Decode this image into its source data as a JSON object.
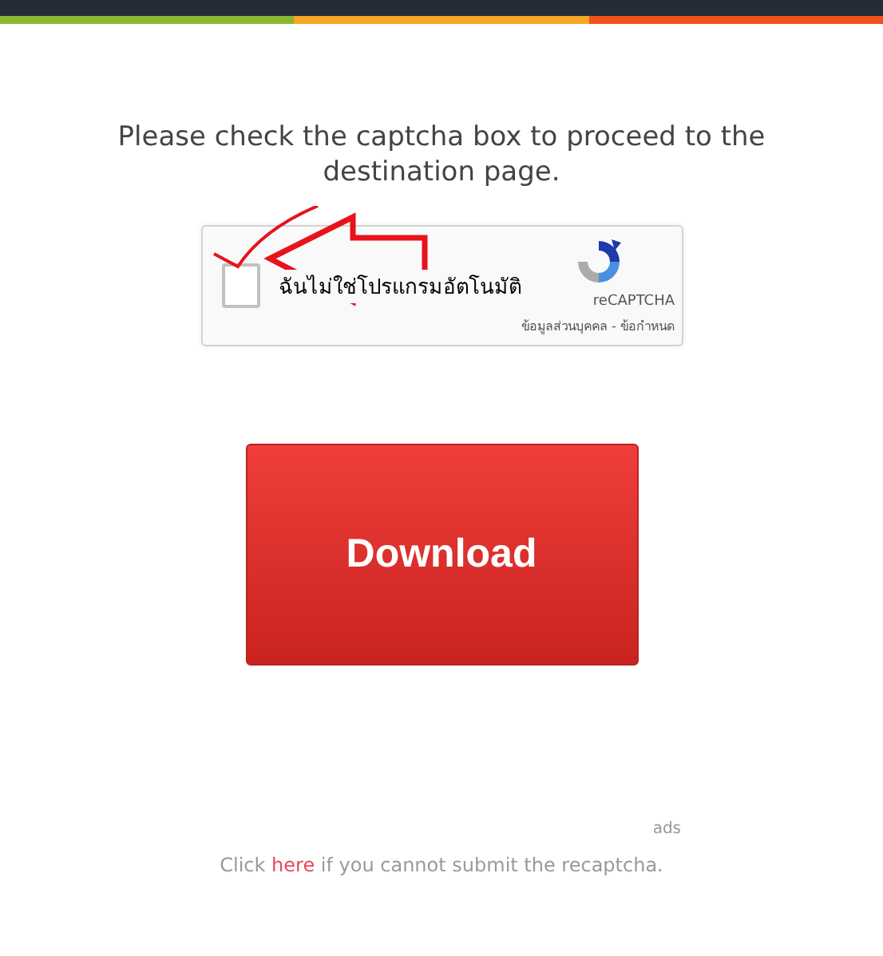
{
  "header": {
    "stripes": [
      {
        "color": "#8bb833"
      },
      {
        "color": "#f5a623"
      },
      {
        "color": "#f2511c"
      }
    ]
  },
  "message": "Please check the captcha box to proceed to the destination page.",
  "captcha": {
    "label": "ฉันไม่ใช่โปรแกรมอัตโนมัติ",
    "checked": false,
    "brand": "reCAPTCHA",
    "privacy": "ข้อมูลส่วนบุคคล",
    "separator": " - ",
    "terms": "ข้อกำหนด"
  },
  "download_button": "Download",
  "ads_label": "ads",
  "footer": {
    "before": "Click ",
    "link": "here",
    "after": " if you cannot submit the recaptcha."
  }
}
